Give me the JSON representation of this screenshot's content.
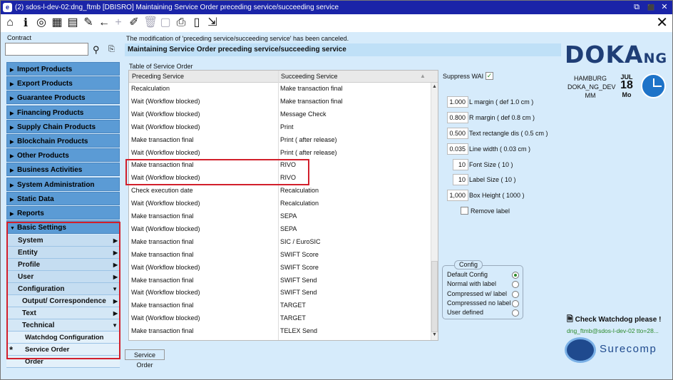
{
  "window": {
    "title": "(2) sdos-l-dev-02:dng_ftmb [DBISRO] Maintaining Service Order preceding service/succeeding service",
    "app_icon": "e",
    "minimize_glyph": "⧉",
    "restore_glyph": "⬛",
    "close_glyph": "✕"
  },
  "toolbar": {
    "icons": [
      "home-icon",
      "info-icon",
      "target-icon",
      "map-icon",
      "book-icon",
      "edit-icon",
      "back-arrow-icon",
      "add-icon",
      "pencil-icon",
      "delete-icon",
      "document-icon",
      "print-icon",
      "device-icon",
      "export-icon"
    ],
    "close_glyph": "✕"
  },
  "left": {
    "contract_label": "Contract",
    "contract_value": "",
    "nav": [
      "Import Products",
      "Export Products",
      "Guarantee Products",
      "Financing Products",
      "Supply Chain Products",
      "Blockchain Products",
      "Other Products",
      "Business Activities",
      "System Administration",
      "Static Data",
      "Reports"
    ],
    "basic_settings": "Basic Settings",
    "sub": [
      {
        "label": "System",
        "arrow": "▶"
      },
      {
        "label": "Entity",
        "arrow": "▶"
      },
      {
        "label": "Profile",
        "arrow": "▶"
      },
      {
        "label": "User",
        "arrow": "▶"
      },
      {
        "label": "Configuration",
        "arrow": "▼"
      }
    ],
    "config_sub": [
      {
        "label": "Output/ Correspondence",
        "arrow": "▶"
      },
      {
        "label": "Text",
        "arrow": "▶"
      },
      {
        "label": "Technical",
        "arrow": "▼"
      }
    ],
    "tech_sub": [
      "Watchdog Configuration",
      "Service Order"
    ],
    "active_marker": "*",
    "order": "Order"
  },
  "main": {
    "message": "The modification of 'preceding service/succeeding service' has been canceled.",
    "heading": "Maintaining Service Order preceding service/succeeding service",
    "table_caption": "Table of Service Order",
    "col1": "Preceding Service",
    "col2": "Succeeding Service",
    "rows": [
      [
        "Recalculation",
        "Make transaction final"
      ],
      [
        "Wait (Workflow blocked)",
        "Make transaction final"
      ],
      [
        "Wait (Workflow blocked)",
        "Message Check"
      ],
      [
        "Wait (Workflow blocked)",
        "Print"
      ],
      [
        "Make transaction final",
        "Print ( after release)"
      ],
      [
        "Wait (Workflow blocked)",
        "Print ( after release)"
      ],
      [
        "Make transaction final",
        "RIVO"
      ],
      [
        "Wait (Workflow blocked)",
        "RIVO"
      ],
      [
        "Check execution date",
        "Recalculation"
      ],
      [
        "Wait (Workflow blocked)",
        "Recalculation"
      ],
      [
        "Make transaction final",
        "SEPA"
      ],
      [
        "Wait (Workflow blocked)",
        "SEPA"
      ],
      [
        "Make transaction final",
        "SIC / EuroSIC"
      ],
      [
        "Make transaction final",
        "SWIFT Score"
      ],
      [
        "Wait (Workflow blocked)",
        "SWIFT Score"
      ],
      [
        "Make transaction final",
        "SWIFT Send"
      ],
      [
        "Wait (Workflow blocked)",
        "SWIFT Send"
      ],
      [
        "Make transaction final",
        "TARGET"
      ],
      [
        "Wait (Workflow blocked)",
        "TARGET"
      ],
      [
        "Make transaction final",
        "TELEX Send"
      ]
    ],
    "bottom_tab": "Service Order"
  },
  "options": {
    "suppress_label": "Suppress WAI",
    "suppress_checked": "✓",
    "fields": [
      {
        "value": "1.000",
        "label": "L margin ( def 1.0 cm )"
      },
      {
        "value": "0.800",
        "label": "R margin ( def 0.8 cm )"
      },
      {
        "value": "0.500",
        "label": "Text rectangle dis ( 0.5 cm )"
      },
      {
        "value": "0.035",
        "label": "Line width ( 0.03 cm )"
      },
      {
        "value": "10",
        "label": "Font Size ( 10 )"
      },
      {
        "value": "10",
        "label": "Label Size ( 10 )"
      },
      {
        "value": "1,000",
        "label": "Box Height ( 1000 )"
      }
    ],
    "remove_label": "Remove label",
    "config_title": "Config",
    "config_options": [
      "Default Config",
      "Normal with label",
      "Compressed w/ label",
      "Compresssed no label",
      "User defined"
    ]
  },
  "brand": {
    "logo_main": "DOKA",
    "logo_sub": "NG",
    "location": "HAMBURG",
    "system": "DOKA_NG_DEV",
    "user_short": "MM",
    "month": "JUL",
    "day": "18",
    "weekday": "Mo",
    "watchdog": "Check Watchdog please !",
    "user_line": "dng_ftmb@sdos-l-dev-02 tto=28...",
    "surecomp": "Surecomp"
  },
  "colors": {
    "titlebar": "#1a24a8",
    "nav": "#5b9bd5",
    "highlight_border": "#d21f2b",
    "background": "#d6ebfb"
  }
}
